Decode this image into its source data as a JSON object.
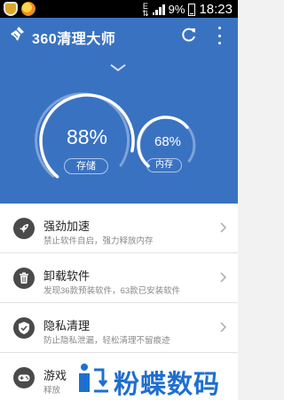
{
  "status_bar": {
    "network_type": "E",
    "battery": "9%",
    "time": "18:23"
  },
  "app": {
    "title": "360清理大师"
  },
  "gauges": {
    "storage": {
      "value": "88%",
      "label": "存储",
      "fraction": 0.88
    },
    "memory": {
      "value": "68%",
      "label": "内存",
      "fraction": 0.68
    }
  },
  "items": [
    {
      "title": "强劲加速",
      "desc": "禁止软件自启，强力释放内存",
      "icon": "rocket-icon"
    },
    {
      "title": "卸载软件",
      "desc": "发现36款预装软件，63款已安装软件",
      "icon": "trash-icon"
    },
    {
      "title": "隐私清理",
      "desc": "防止隐私泄漏，轻松清理不留痕迹",
      "icon": "shield-icon"
    },
    {
      "title": "游戏",
      "desc": "释放",
      "icon": "gamepad-icon"
    }
  ],
  "watermark": {
    "text": "粉蝶数码"
  },
  "colors": {
    "hero": "#3a72c2",
    "accent_white": "#ffffff",
    "icon_bg": "#4a4a4a",
    "watermark": "#1f6fcf"
  }
}
